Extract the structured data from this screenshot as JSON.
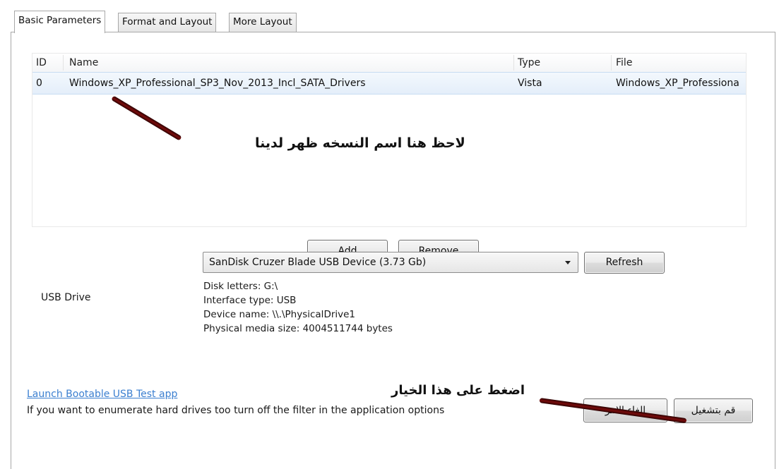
{
  "tabs": [
    {
      "label": "Basic Parameters",
      "active": true
    },
    {
      "label": "Format and Layout",
      "active": false
    },
    {
      "label": "More Layout",
      "active": false
    }
  ],
  "table": {
    "columns": [
      "ID",
      "Name",
      "Type",
      "File"
    ],
    "rows": [
      {
        "id": "0",
        "name": "Windows_XP_Professional_SP3_Nov_2013_Incl_SATA_Drivers",
        "type": "Vista",
        "file": "Windows_XP_Professiona"
      }
    ]
  },
  "buttons": {
    "add": "Add",
    "remove": "Remove",
    "refresh": "Refresh",
    "run": "قم بتشغيل",
    "cancel": "الغاء الامر"
  },
  "usb": {
    "label": "USB Drive",
    "selected": "SanDisk Cruzer Blade USB Device (3.73 Gb)",
    "info": {
      "disk_letters": "Disk letters: G:\\",
      "interface_type": "Interface type: USB",
      "device_name": "Device name: \\\\.\\PhysicalDrive1",
      "media_size": "Physical media size: 4004511744 bytes"
    }
  },
  "footer": {
    "link": "Launch Bootable USB Test app",
    "note": "If you want to enumerate hard drives too turn off the filter in the application options"
  },
  "annotations": {
    "name_note": "لاحظ هنا اسم النسخه ظهر لدينا",
    "click_note": "اضغط على هذا الخيار"
  },
  "colors": {
    "selection": "#e4eefa",
    "link": "#3b7fd0",
    "arrow": "#5a0a0a"
  },
  "icons": {
    "dropdown": "chevron-down-icon"
  }
}
